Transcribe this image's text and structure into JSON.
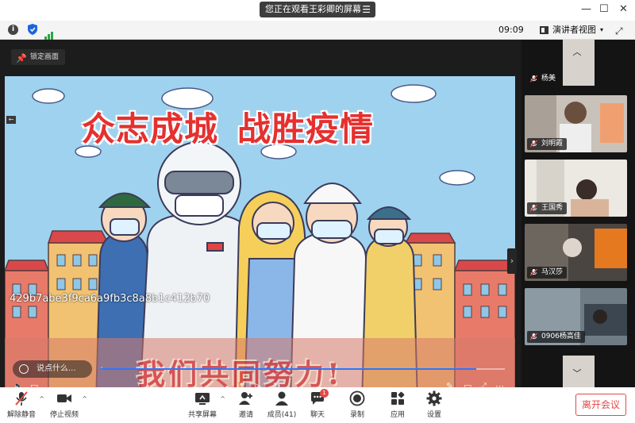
{
  "banner": {
    "text": "您正在观看王彩卿的屏幕",
    "menu_icon": "hamburger-icon"
  },
  "window": {
    "minimize": "—",
    "maximize": "☐",
    "close": "✕"
  },
  "topbar": {
    "info_icon": "i",
    "time": "09:09",
    "view_label": "演讲者视图",
    "view_caret": "▾",
    "fullscreen": "⤢"
  },
  "stage": {
    "lock_label": "锁定画面",
    "slogan_left": "众志成城",
    "slogan_right": "战胜疫情",
    "subslogan": "我们共同努力!",
    "meeting_hash": "429b7abe3f9ca6a9fb3c8a8b1c412b70",
    "chat_placeholder": "说点什么...",
    "chat_arrow": "‹",
    "playback_progress": 0.93
  },
  "participants": [
    {
      "name": "杨美",
      "muted": true
    },
    {
      "name": "刘明霞",
      "muted": true
    },
    {
      "name": "王国秀",
      "muted": true
    },
    {
      "name": "马汉莎",
      "muted": true
    },
    {
      "name": "0906杨高佳",
      "muted": true
    }
  ],
  "toolbar": {
    "unmute": "解除静音",
    "stop_video": "停止视频",
    "share_screen": "共享屏幕",
    "invite": "邀请",
    "members": "成员(41)",
    "chat": "聊天",
    "chat_badge": "1",
    "record": "录制",
    "apps": "应用",
    "settings": "设置",
    "leave": "离开会议",
    "caret": "^"
  },
  "colors": {
    "accent": "#2a78ff",
    "danger": "#e04a4a",
    "signal": "#2aa745",
    "slogan_red": "#e5302f"
  }
}
